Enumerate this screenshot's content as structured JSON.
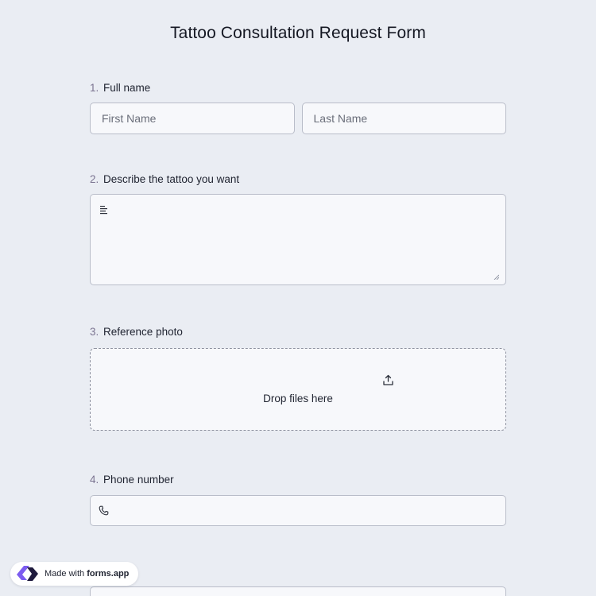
{
  "form": {
    "title": "Tattoo Consultation Request Form",
    "questions": [
      {
        "number": "1.",
        "label": "Full name",
        "placeholders": [
          "First Name",
          "Last Name"
        ]
      },
      {
        "number": "2.",
        "label": "Describe the tattoo you want"
      },
      {
        "number": "3.",
        "label": "Reference photo",
        "drop_text": "Drop files here"
      },
      {
        "number": "4.",
        "label": "Phone number"
      }
    ]
  },
  "badge": {
    "prefix": "Made with",
    "brand": "forms.app"
  },
  "colors": {
    "background": "#eaedf3",
    "field": "#f7f8fb",
    "border": "#b9bdc9",
    "number": "#7a7390",
    "brand_purple": "#7c5cf0"
  },
  "icons": [
    "text-lines-icon",
    "resize-handle-icon",
    "upload-icon",
    "phone-icon",
    "forms-app-logo-icon"
  ]
}
